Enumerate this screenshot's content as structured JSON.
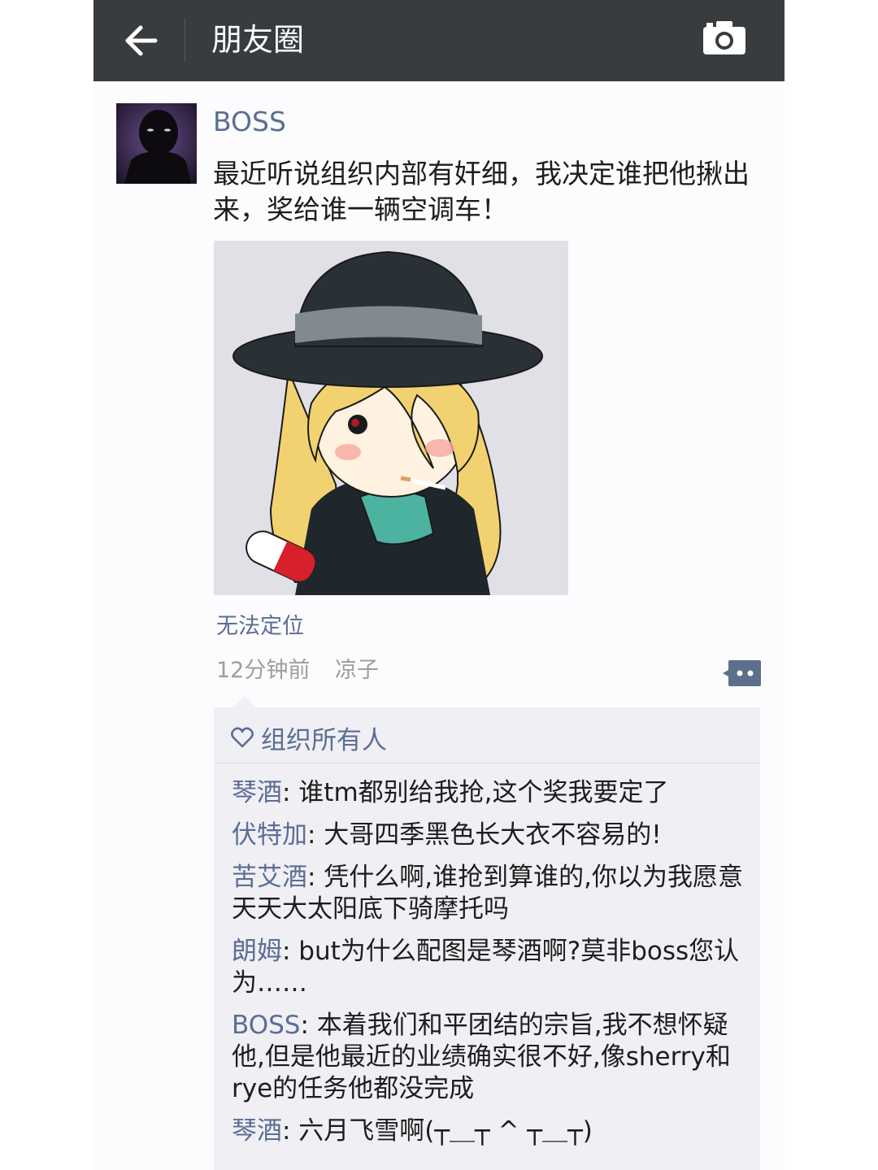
{
  "header": {
    "title": "朋友圈",
    "back_icon": "arrow-left-icon",
    "camera_icon": "camera-icon"
  },
  "post": {
    "author": "BOSS",
    "text": "最近听说组织内部有奸细，我决定谁把他揪出来，奖给谁一辆空调车！",
    "location": "无法定位",
    "time": "12分钟前",
    "source": "凉子"
  },
  "likes": {
    "names": "组织所有人"
  },
  "comments": [
    {
      "author": "琴酒",
      "text": ": 谁tm都别给我抢,这个奖我要定了"
    },
    {
      "author": "伏特加",
      "text": ": 大哥四季黑色长大衣不容易的!"
    },
    {
      "author": "苦艾酒",
      "text": ": 凭什么啊,谁抢到算谁的,你以为我愿意天天大太阳底下骑摩托吗"
    },
    {
      "author": "朗姆",
      "text": ": but为什么配图是琴酒啊?莫非boss您认为……"
    },
    {
      "author": "BOSS",
      "text": ": 本着我们和平团结的宗旨,我不想怀疑他,但是他最近的业绩确实很不好,像sherry和rye的任务他都没完成"
    },
    {
      "author": "琴酒",
      "text": ": 六月飞雪啊(┬＿┬ ^ ┬＿┬)"
    }
  ],
  "colors": {
    "topbar": "#383c3f",
    "link": "#5a6e93",
    "comment_bg": "#f0eff4"
  }
}
